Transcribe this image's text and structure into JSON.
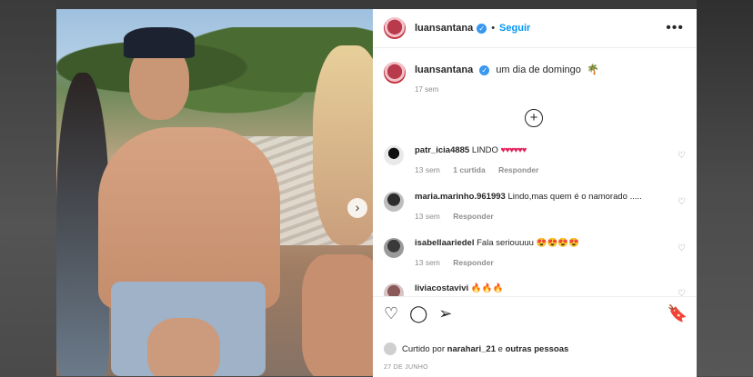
{
  "post": {
    "username": "luansantana",
    "follow_label": "Seguir",
    "more_icon": "•••",
    "caption_text": "um dia de domingo",
    "caption_emoji": "🌴",
    "time_ago": "17 sem"
  },
  "comments": [
    {
      "user": "patr_icia4885",
      "text": "LINDO",
      "emoji": "♥♥♥♥♥♥",
      "time": "13 sem",
      "likes": "1 curtida",
      "reply": "Responder",
      "avatar_color": "#4b4b4b"
    },
    {
      "user": "maria.marinho.961993",
      "text": "Lindo,mas quem é o namorado .....",
      "emoji": "",
      "time": "13 sem",
      "likes": "",
      "reply": "Responder",
      "avatar_color": "#3a3a3a"
    },
    {
      "user": "isabellaariedel",
      "text": "Fala seriouuuu",
      "emoji": "😍😍😍😍",
      "time": "13 sem",
      "likes": "",
      "reply": "Responder",
      "avatar_color": "#555555"
    },
    {
      "user": "liviacostavivi",
      "text": "",
      "emoji": "🔥🔥🔥",
      "time": "",
      "likes": "",
      "reply": "",
      "avatar_color": "#6b5a5a"
    }
  ],
  "actions": {
    "liked_prefix": "Curtido por",
    "liked_user": "narahari_21",
    "liked_joiner": "e",
    "liked_rest": "outras pessoas",
    "date": "27 DE JUNHO"
  }
}
